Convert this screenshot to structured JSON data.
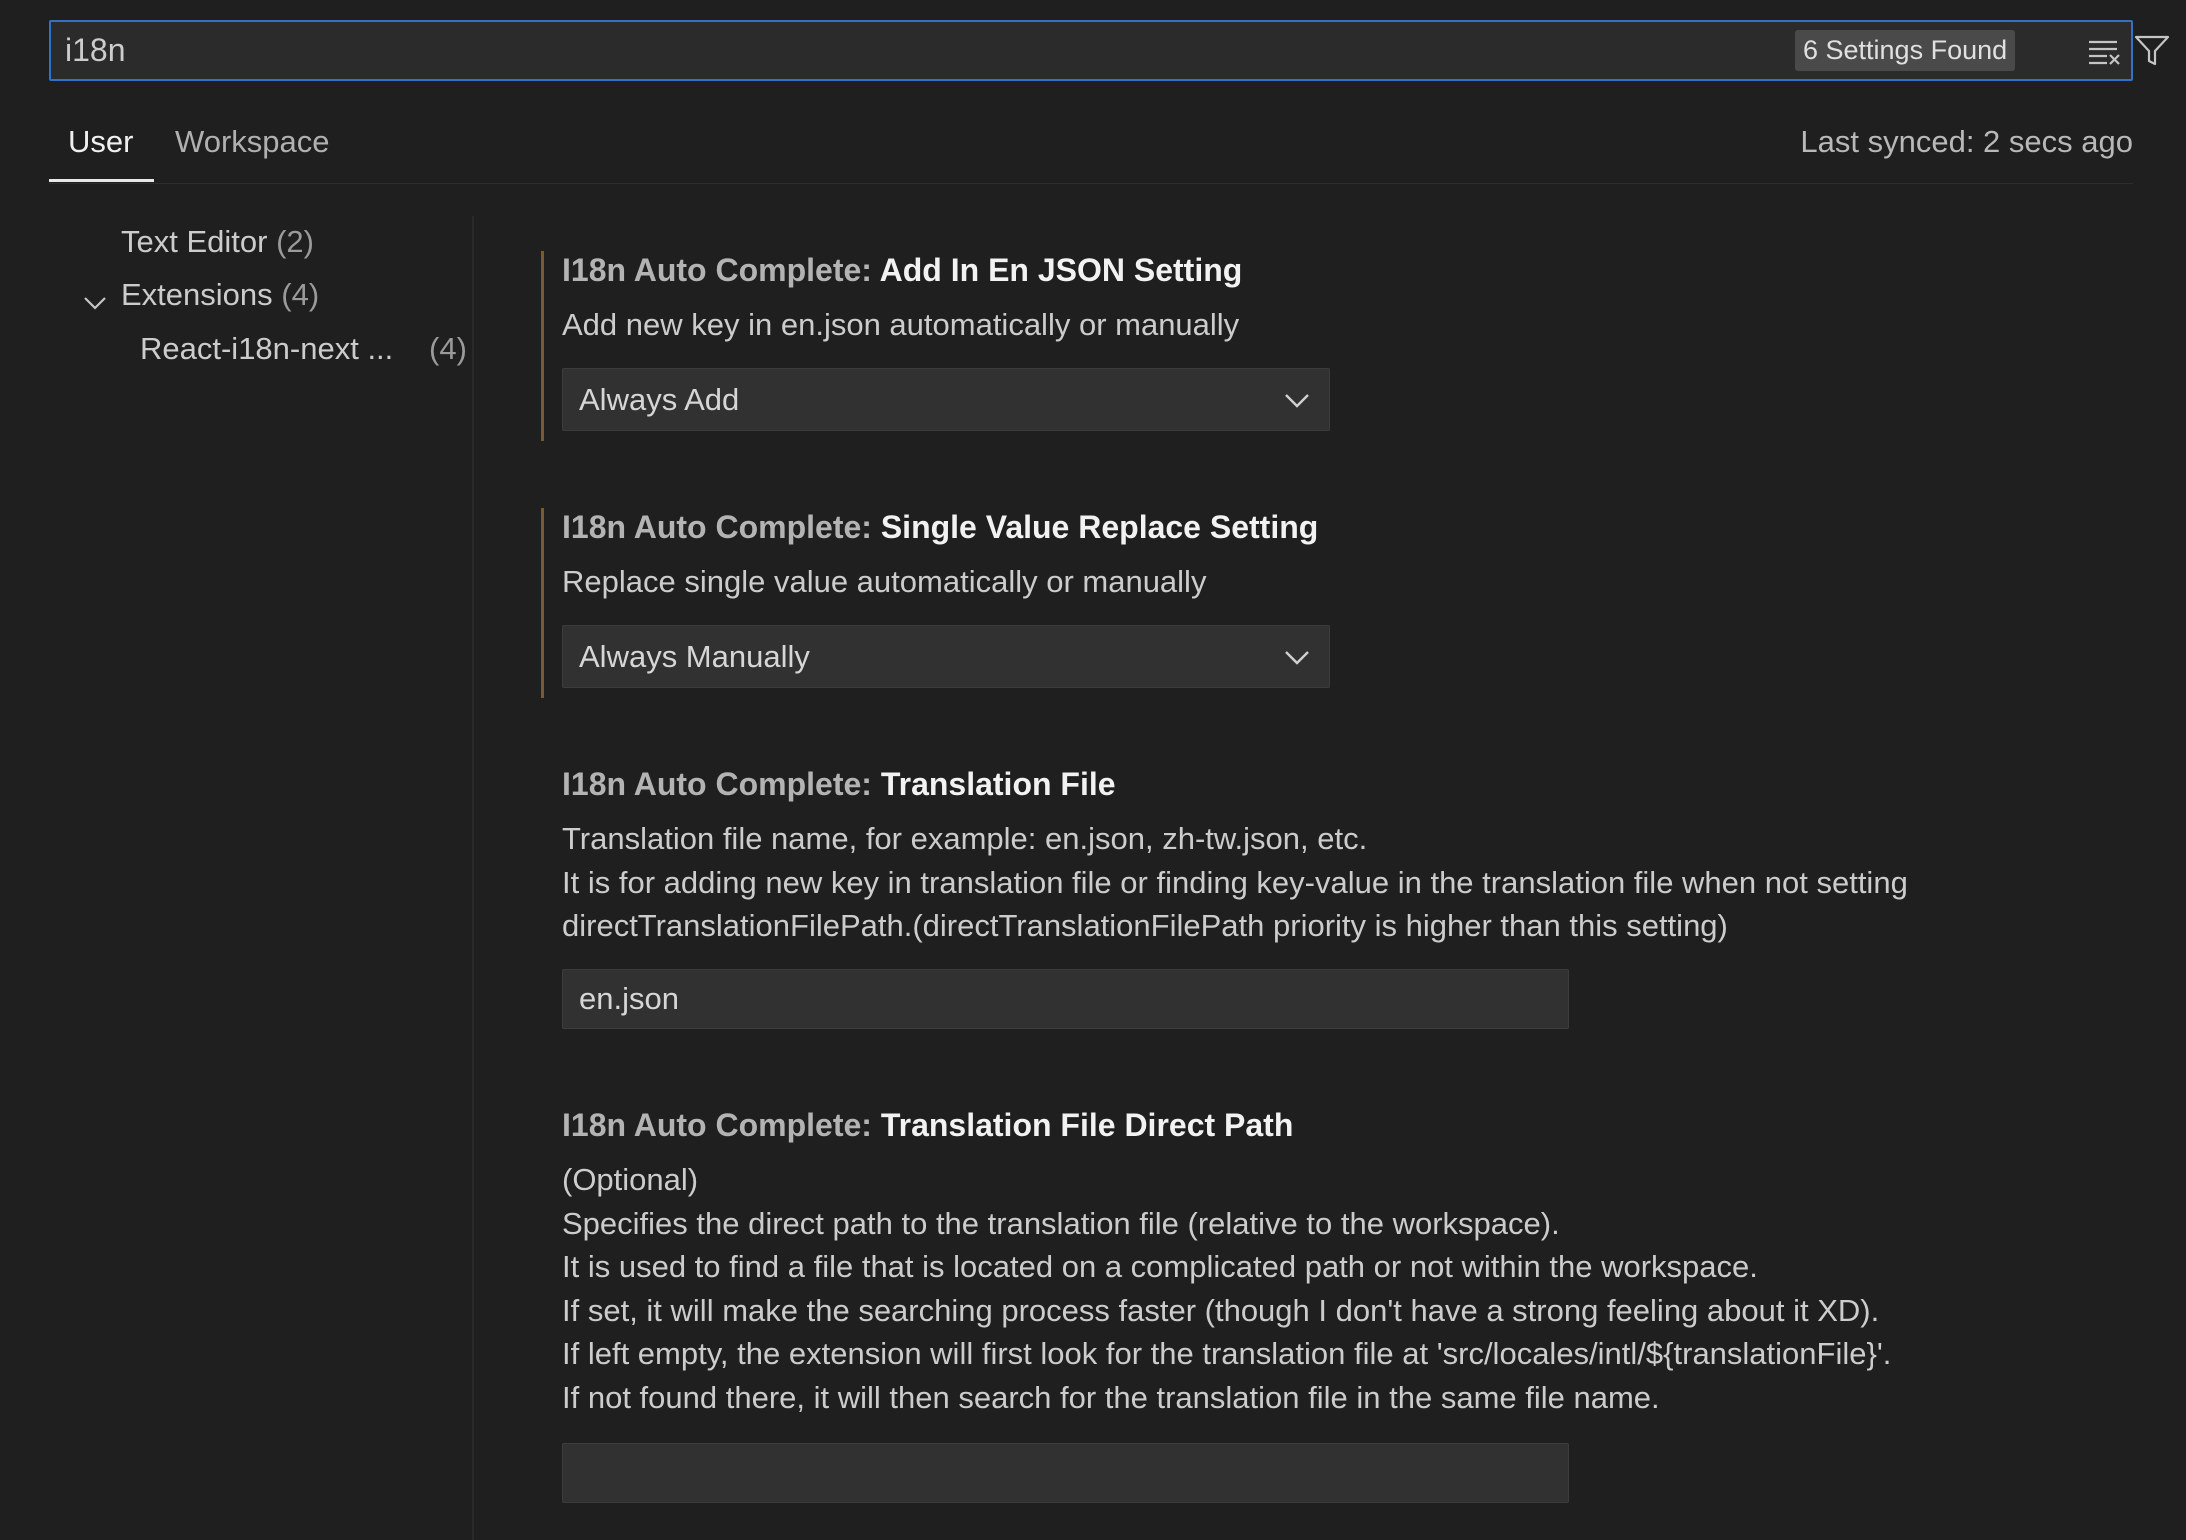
{
  "search": {
    "value": "i18n",
    "results_badge": "6 Settings Found",
    "clear_icon": "clear-all-icon",
    "filter_icon": "filter-icon"
  },
  "tabs": {
    "user": "User",
    "workspace": "Workspace",
    "active": "User"
  },
  "sync_status": "Last synced: 2 secs ago",
  "toc": {
    "items": [
      {
        "label": "Text Editor",
        "count": "(2)"
      },
      {
        "label": "Extensions",
        "count": "(4)",
        "expanded": true
      },
      {
        "label": "React-i18n-next ...",
        "count": "(4)"
      }
    ]
  },
  "settings": [
    {
      "category": "I18n Auto Complete: ",
      "label": "Add In En JSON Setting",
      "description": [
        "Add new key in en.json automatically or manually"
      ],
      "control": "select",
      "value": "Always Add",
      "modified": true
    },
    {
      "category": "I18n Auto Complete: ",
      "label": "Single Value Replace Setting",
      "description": [
        "Replace single value automatically or manually"
      ],
      "control": "select",
      "value": "Always Manually",
      "modified": true
    },
    {
      "category": "I18n Auto Complete: ",
      "label": "Translation File",
      "description": [
        "Translation file name, for example: en.json, zh-tw.json, etc.",
        "It is for adding new key in translation file or finding key-value in the translation file when not setting",
        "directTranslationFilePath.(directTranslationFilePath priority is higher than this setting)"
      ],
      "control": "text",
      "value": "en.json",
      "modified": false
    },
    {
      "category": "I18n Auto Complete: ",
      "label": "Translation File Direct Path",
      "description": [
        "(Optional)",
        "Specifies the direct path to the translation file (relative to the workspace).",
        "It is used to find a file that is located on a complicated path or not within the workspace.",
        "If set, it will make the searching process faster (though I don't have a strong feeling about it XD).",
        "If left empty, the extension will first look for the translation file at 'src/locales/intl/${translationFile}'.",
        "If not found there, it will then search for the translation file in the same file name."
      ],
      "control": "text",
      "value": "",
      "modified": false
    }
  ],
  "colors": {
    "background": "#1f1f1f",
    "focus_border": "#2f72c8",
    "modified_indicator": "#7a5a30",
    "input_background": "#313131"
  }
}
